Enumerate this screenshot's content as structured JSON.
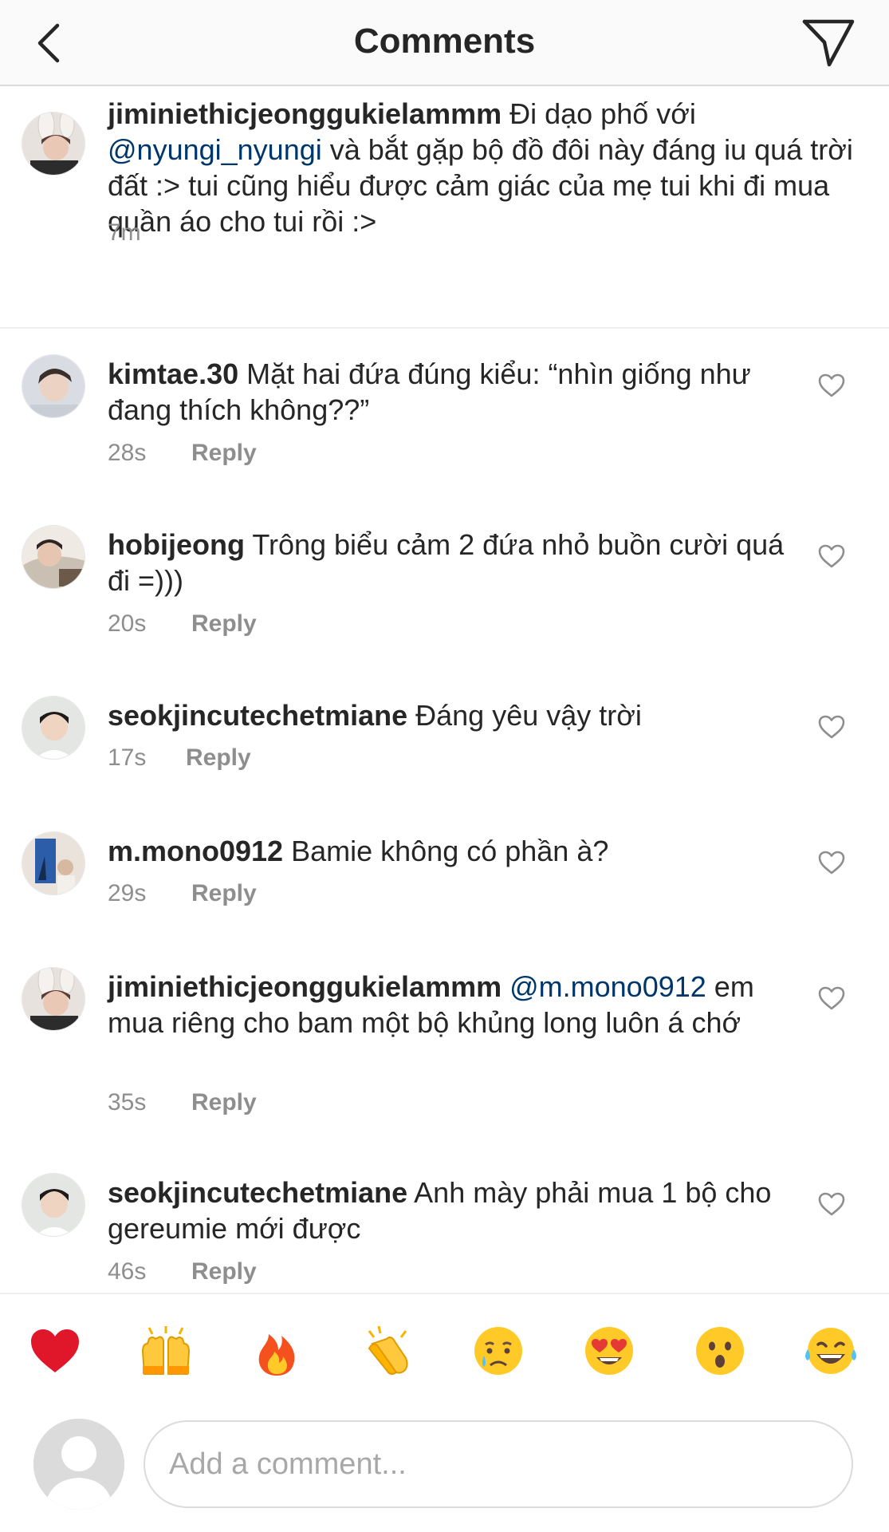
{
  "header": {
    "title": "Comments",
    "back_icon": "chevron-left-icon",
    "share_icon": "paper-plane-icon"
  },
  "caption": {
    "username": "jiminiethicjeonggukielammm",
    "text_before": " Đi dạo phố với ",
    "mention": "@nyungi_nyungi",
    "text_after": " và bắt gặp bộ đồ đôi này đáng iu quá trời đất :> tui cũng hiểu được cảm giác của mẹ tui khi đi mua quần áo cho tui rồi :>",
    "time": "7m"
  },
  "comments": [
    {
      "username": "kimtae.30",
      "text": " Mặt hai đứa đúng kiểu: “nhìn giống như đang thích không??”",
      "time": "28s",
      "reply": "Reply"
    },
    {
      "username": "hobijeong",
      "text": " Trông biểu cảm 2 đứa nhỏ buồn cười quá đi =)))",
      "time": "20s",
      "reply": "Reply"
    },
    {
      "username": "seokjincutechetmiane",
      "text": " Đáng yêu vậy trời",
      "time": "17s",
      "reply": "Reply"
    },
    {
      "username": "m.mono0912",
      "text": " Bamie không có phần à?",
      "time": "29s",
      "reply": "Reply"
    },
    {
      "username": "jiminiethicjeonggukielammm",
      "mention": " @m.mono0912",
      "text": " em mua riêng cho bam một bộ khủng long luôn á chớ",
      "time": "35s",
      "reply": "Reply"
    },
    {
      "username": "seokjincutechetmiane",
      "text": " Anh mày phải mua 1 bộ cho gereumie mới được",
      "time": "46s",
      "reply": "Reply"
    }
  ],
  "emoji_bar": [
    "❤️",
    "🙌",
    "🔥",
    "👏",
    "😢",
    "😍",
    "😮",
    "😂"
  ],
  "compose": {
    "placeholder": "Add a comment..."
  },
  "colors": {
    "text": "#262626",
    "muted": "#8e8e8e",
    "mention": "#00376b",
    "divider": "#efefef",
    "header_bg": "#fafafa"
  }
}
